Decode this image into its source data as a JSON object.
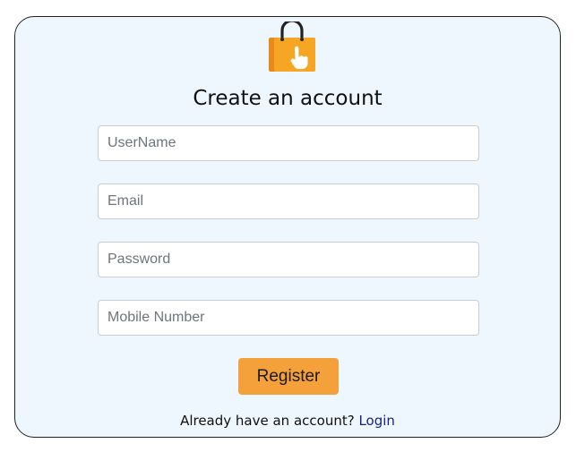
{
  "brand": {
    "logo_icon": "shopping-bag-hand-icon",
    "bag_color": "#f6a623",
    "bag_shadow_color": "#e8891a",
    "handle_color": "#222222"
  },
  "form": {
    "title": "Create an account",
    "username_placeholder": "UserName",
    "email_placeholder": "Email",
    "password_placeholder": "Password",
    "mobile_placeholder": "Mobile Number",
    "register_label": "Register",
    "button_color": "#f4a03b"
  },
  "footer": {
    "prompt": "Already have an account?",
    "login_label": "Login"
  }
}
